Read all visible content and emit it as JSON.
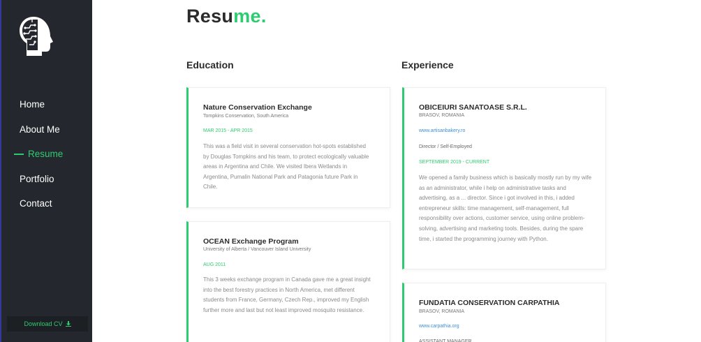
{
  "sidebar": {
    "nav": [
      {
        "label": "Home"
      },
      {
        "label": "About Me"
      },
      {
        "label": "Resume",
        "active": true
      },
      {
        "label": "Portfolio"
      },
      {
        "label": "Contact"
      }
    ],
    "download_label": "Download CV",
    "download_icon": "download-icon"
  },
  "page": {
    "title_main": "Resu",
    "title_accent": "me."
  },
  "education": {
    "heading": "Education",
    "items": [
      {
        "title": "Nature Conservation Exchange",
        "subtitle": "Tompkins Conservation, South America",
        "date": "MAR 2015 - APR 2015",
        "description": "This was a field visit in several conservation hot-spots established by Douglas Tompkins and his team, to protect ecologically valuable areas in Argentina and Chile. We visited Ibera Wetlands in Argentina, Pumalin National Park and Patagonia future Park in Chile."
      },
      {
        "title": "OCEAN Exchange Program",
        "subtitle": "University of Alberta / Vancouver Island University",
        "date": "AUG 2011",
        "description": "This 3 weeks exchange program in Canada gave me a great insight into the best forestry practices in North America, met different students from France, Germany, Czech Rep., improved my English further more and last but not least improved mosquito resistance."
      }
    ]
  },
  "experience": {
    "heading": "Experience",
    "items": [
      {
        "title": "OBICEIURI SANATOASE S.R.L.",
        "subtitle": "BRASOV, ROMANIA",
        "link": "www.artisanbakery.ro",
        "role": "Director / Self-Employed",
        "date": "SEPTEMBER 2019 - CURRENT",
        "description": "We opened a family business which is basically mostly run by my wife as an administrator, while i help on administrative tasks and advertising, as a ... director. Since i got involved in this, i added entrepreneur skills: time management, self-management, full responsibility over actions, customer service, using online problem-solving, advertising and marketing tools. Besides, during the spare time, i started the programming journey with Python."
      },
      {
        "title": "FUNDATIA CONSERVATION CARPATHIA",
        "subtitle": "BRASOV, ROMANIA",
        "link": "www.carpathia.org",
        "role": "ASSISTANT MANAGER"
      }
    ]
  },
  "colors": {
    "accent": "#2ecc71",
    "sidebar_bg": "#24272d",
    "link": "#3b8fd6"
  }
}
